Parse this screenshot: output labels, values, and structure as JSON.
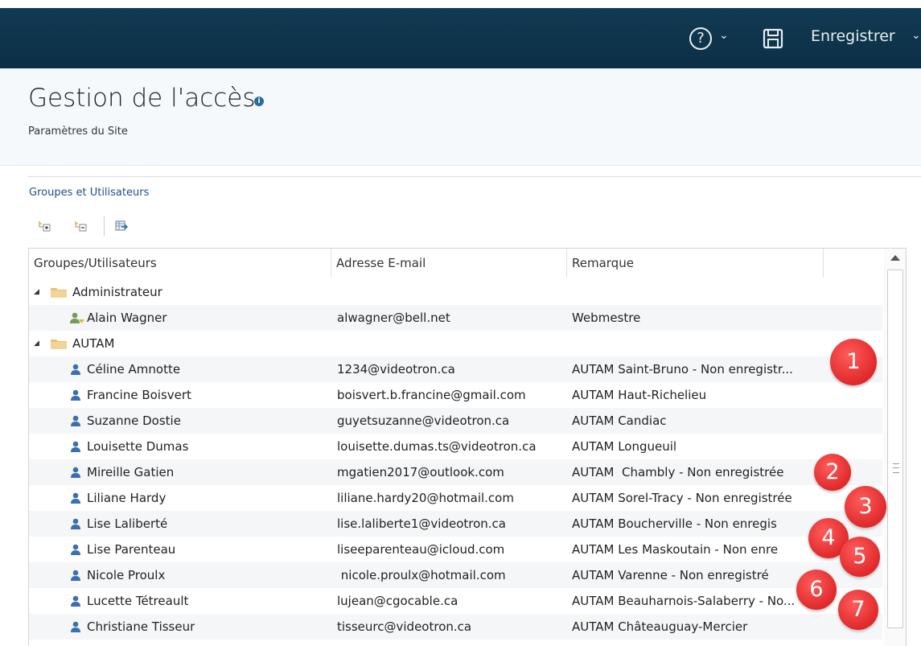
{
  "topbar": {
    "save_label": "Enregistrer"
  },
  "header": {
    "title": "Gestion de l'accès",
    "subtitle": "Paramètres du Site"
  },
  "section": {
    "title": "Groupes et Utilisateurs"
  },
  "table": {
    "columns": [
      "Groupes/Utilisateurs",
      "Adresse E-mail",
      "Remarque"
    ],
    "rows": [
      {
        "type": "group",
        "name": "Administrateur",
        "email": "",
        "remark": ""
      },
      {
        "type": "admin",
        "name": "Alain Wagner",
        "email": "alwagner@bell.net",
        "remark": "Webmestre"
      },
      {
        "type": "group",
        "name": "AUTAM",
        "email": "",
        "remark": ""
      },
      {
        "type": "user",
        "name": "Céline Amnotte",
        "email": "1234@videotron.ca",
        "remark": "AUTAM Saint-Bruno - Non enregistr..."
      },
      {
        "type": "user",
        "name": "Francine Boisvert",
        "email": "boisvert.b.francine@gmail.com",
        "remark": "AUTAM Haut-Richelieu"
      },
      {
        "type": "user",
        "name": "Suzanne Dostie",
        "email": "guyetsuzanne@videotron.ca",
        "remark": "AUTAM Candiac"
      },
      {
        "type": "user",
        "name": "Louisette Dumas",
        "email": "louisette.dumas.ts@videotron.ca",
        "remark": "AUTAM Longueuil"
      },
      {
        "type": "user",
        "name": "Mireille Gatien",
        "email": "mgatien2017@outlook.com",
        "remark": "AUTAM  Chambly - Non enregistrée"
      },
      {
        "type": "user",
        "name": "Liliane Hardy",
        "email": "liliane.hardy20@hotmail.com",
        "remark": "AUTAM Sorel-Tracy - Non enregistrée"
      },
      {
        "type": "user",
        "name": "Lise Laliberté",
        "email": "lise.laliberte1@videotron.ca",
        "remark": "AUTAM Boucherville - Non enregis"
      },
      {
        "type": "user",
        "name": "Lise Parenteau",
        "email": "liseeparenteau@icloud.com",
        "remark": "AUTAM Les Maskoutain - Non enre"
      },
      {
        "type": "user",
        "name": "Nicole Proulx",
        "email": " nicole.proulx@hotmail.com",
        "remark": "AUTAM Varenne - Non enregistré"
      },
      {
        "type": "user",
        "name": "Lucette Tétreault",
        "email": "lujean@cgocable.ca",
        "remark": "AUTAM Beauharnois-Salaberry - No..."
      },
      {
        "type": "user",
        "name": "Christiane Tisseur",
        "email": "tisseurc@videotron.ca",
        "remark": "AUTAM Châteauguay-Mercier"
      }
    ]
  },
  "annotations": [
    "1",
    "2",
    "3",
    "4",
    "5",
    "6",
    "7"
  ],
  "icons": {
    "help": "help-circle-icon",
    "save": "save-icon",
    "group": "folder-icon",
    "user": "user-icon",
    "admin": "admin-user-icon",
    "toolbar": [
      "expand-all-icon",
      "collapse-all-icon",
      "export-icon"
    ]
  },
  "colors": {
    "topbar": "#0e3550",
    "accent": "#1f4f88",
    "badge": "#e63232",
    "user_icon": "#3a6fb0",
    "folder": "#e8c077"
  }
}
